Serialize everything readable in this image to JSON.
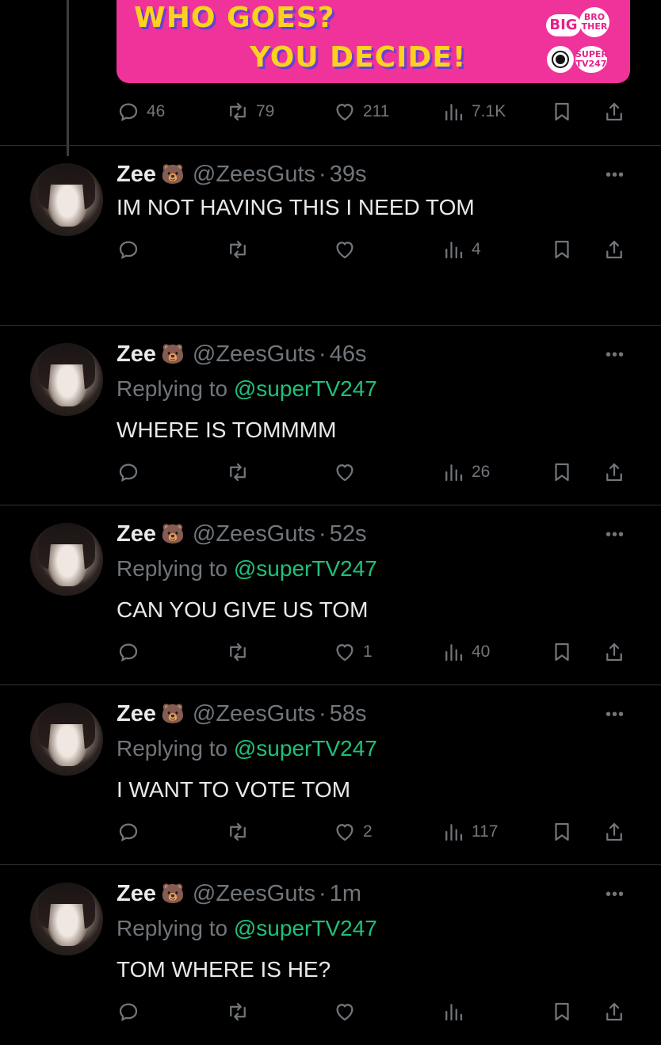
{
  "banner": {
    "line1": "WHO GOES?",
    "line2": "YOU DECIDE!",
    "logo_big": "BIG",
    "logo_brother": "BRO\nTHER",
    "logo_super": "SUPER\nTV247"
  },
  "parent_actions": {
    "replies": "46",
    "retweets": "79",
    "likes": "211",
    "views": "7.1K"
  },
  "tweets": [
    {
      "name": "Zee",
      "emoji": "🐻",
      "handle": "@ZeesGuts",
      "time": "39s",
      "replying_prefix": "",
      "replying_to": "",
      "text": "IM NOT HAVING THIS I NEED TOM",
      "likes": "",
      "views": "4"
    },
    {
      "name": "Zee",
      "emoji": "🐻",
      "handle": "@ZeesGuts",
      "time": "46s",
      "replying_prefix": "Replying to ",
      "replying_to": "@superTV247",
      "text": "WHERE IS TOMMMM",
      "likes": "",
      "views": "26"
    },
    {
      "name": "Zee",
      "emoji": "🐻",
      "handle": "@ZeesGuts",
      "time": "52s",
      "replying_prefix": "Replying to ",
      "replying_to": "@superTV247",
      "text": "CAN YOU GIVE US TOM",
      "likes": "1",
      "views": "40"
    },
    {
      "name": "Zee",
      "emoji": "🐻",
      "handle": "@ZeesGuts",
      "time": "58s",
      "replying_prefix": "Replying to ",
      "replying_to": "@superTV247",
      "text": "I WANT TO VOTE TOM",
      "likes": "2",
      "views": "117"
    },
    {
      "name": "Zee",
      "emoji": "🐻",
      "handle": "@ZeesGuts",
      "time": "1m",
      "replying_prefix": "Replying to ",
      "replying_to": "@superTV247",
      "text": "TOM WHERE IS HE?",
      "likes": "",
      "views": ""
    }
  ],
  "separator": "·",
  "more": "•••",
  "icons": {
    "reply": "reply-icon",
    "retweet": "retweet-icon",
    "like": "heart-icon",
    "views": "views-icon",
    "bookmark": "bookmark-icon",
    "share": "share-icon"
  },
  "colors": {
    "background": "#000000",
    "banner": "#f0329b",
    "banner_text": "#ffd21f",
    "mention": "#20c07a",
    "muted": "#71767b"
  }
}
